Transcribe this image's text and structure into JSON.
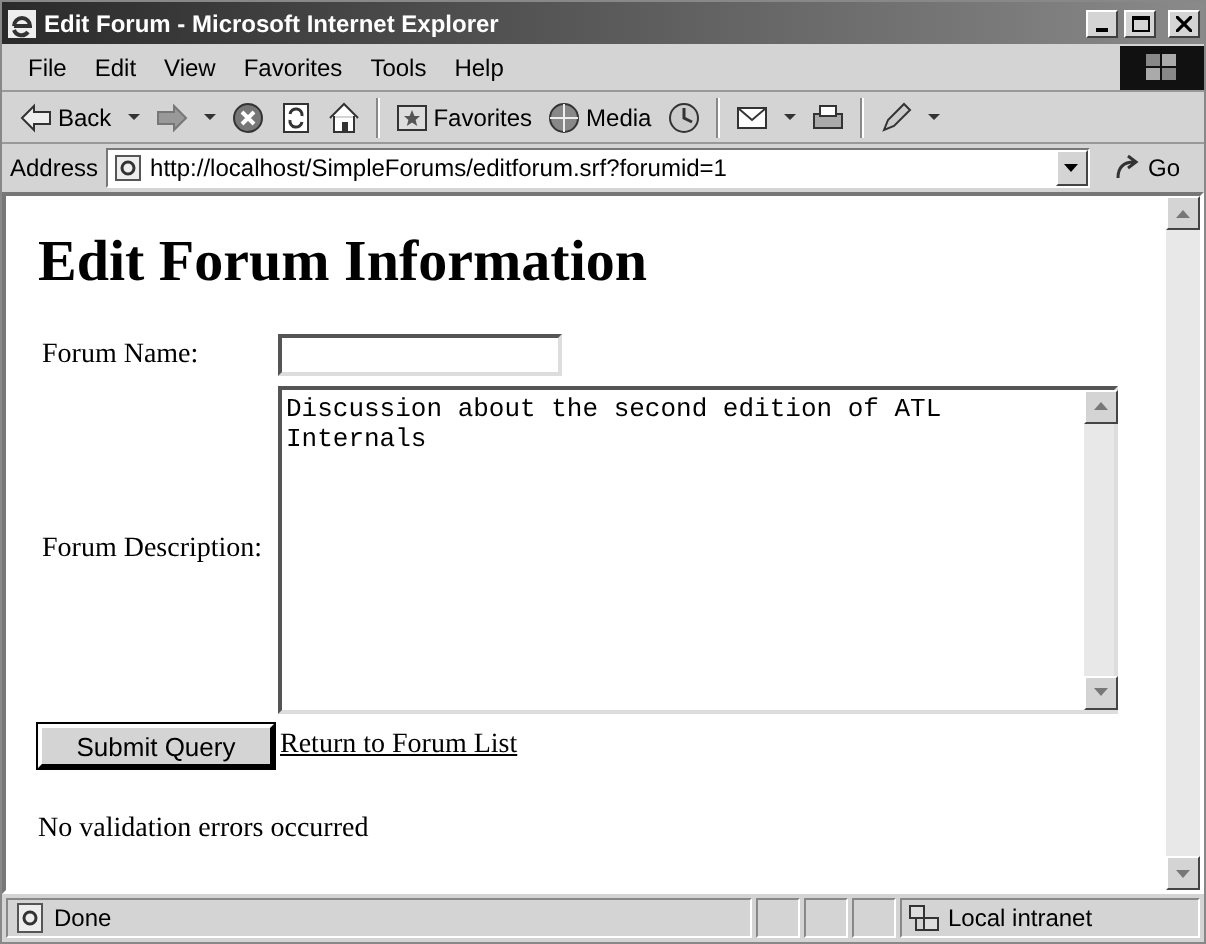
{
  "window": {
    "title": "Edit Forum - Microsoft Internet Explorer"
  },
  "menu": [
    "File",
    "Edit",
    "View",
    "Favorites",
    "Tools",
    "Help"
  ],
  "toolbar": [
    {
      "kind": "back",
      "label": "Back"
    },
    {
      "kind": "dropdown"
    },
    {
      "kind": "forward"
    },
    {
      "kind": "dropdown"
    },
    {
      "kind": "stop"
    },
    {
      "kind": "refresh"
    },
    {
      "kind": "home"
    },
    {
      "kind": "separator"
    },
    {
      "kind": "favorites",
      "label": "Favorites"
    },
    {
      "kind": "media",
      "label": "Media"
    },
    {
      "kind": "history"
    },
    {
      "kind": "separator"
    },
    {
      "kind": "mail"
    },
    {
      "kind": "dropdown"
    },
    {
      "kind": "print"
    },
    {
      "kind": "separator"
    },
    {
      "kind": "edit"
    },
    {
      "kind": "dropdown"
    }
  ],
  "address": {
    "label": "Address",
    "url": "http://localhost/SimpleForums/editforum.srf?forumid=1",
    "go": "Go"
  },
  "page": {
    "heading": "Edit Forum Information",
    "fields": [
      {
        "kind": "text",
        "label": "Forum Name:"
      },
      {
        "kind": "textarea",
        "label": "Forum Description:",
        "value": "Discussion about the second edition of ATL Internals"
      }
    ],
    "submit": "Submit Query",
    "link": "Return to Forum List",
    "message": "No validation errors occurred"
  },
  "status_bar": {
    "text": "Done",
    "zone": "Local intranet"
  }
}
